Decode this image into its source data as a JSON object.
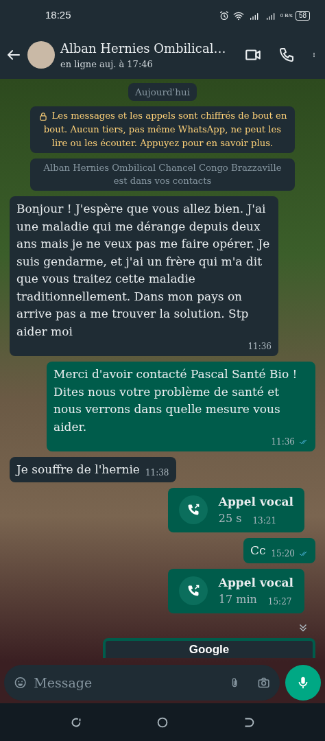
{
  "status_bar": {
    "time": "18:25",
    "net_speed": "0 B/s",
    "battery": "58"
  },
  "header": {
    "title": "Alban Hernies Ombilical…",
    "subtitle": "en ligne auj. à 17:46"
  },
  "date_chip": "Aujourd'hui",
  "system_notes": [
    {
      "kind": "encryption",
      "text": "Les messages et les appels sont chiffrés de bout en bout. Aucun tiers, pas même WhatsApp, ne peut les lire ou les écouter. Appuyez pour en savoir plus."
    },
    {
      "kind": "contact",
      "text": "Alban Hernies Ombilical Chancel Congo Brazzaville est dans vos contacts"
    }
  ],
  "messages": [
    {
      "kind": "text",
      "incoming": true,
      "text": "Bonjour ! J'espère que vous allez bien. J'ai une maladie qui me dérange depuis deux ans mais je ne veux pas me faire opérer. Je suis gendarme, et j'ai un frère qui m'a dit que vous traitez cette maladie traditionnellement. Dans mon pays on arrive pas a me trouver la solution. Stp aider moi",
      "time": "11:36",
      "read": false
    },
    {
      "kind": "text",
      "incoming": false,
      "text": "Merci d'avoir contacté Pascal Santé Bio ! Dites nous votre problème de santé et nous verrons dans quelle mesure vous aider.",
      "time": "11:36",
      "read": true
    },
    {
      "kind": "text",
      "incoming": true,
      "text": "Je souffre de l'hernie",
      "time": "11:38",
      "read": false
    },
    {
      "kind": "call",
      "incoming": false,
      "title": "Appel vocal",
      "duration": "25 s",
      "time": "13:21"
    },
    {
      "kind": "text",
      "incoming": false,
      "text": "Cc",
      "time": "15:20",
      "read": true
    },
    {
      "kind": "call",
      "incoming": false,
      "title": "Appel vocal",
      "duration": "17 min",
      "time": "15:27"
    },
    {
      "kind": "link",
      "incoming": false,
      "text": "Google"
    }
  ],
  "composer": {
    "placeholder": "Message"
  }
}
